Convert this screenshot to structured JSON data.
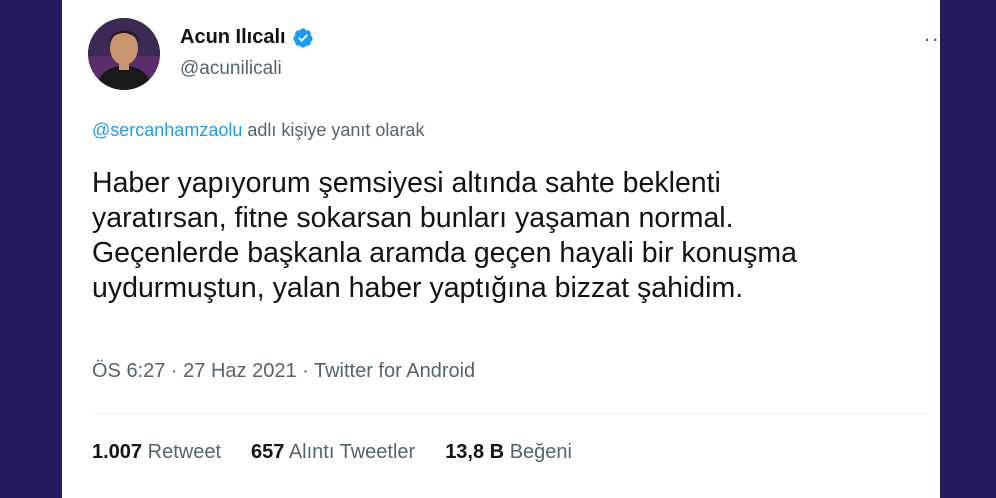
{
  "author": {
    "display_name": "Acun Ilıcalı",
    "handle": "@acunilicali",
    "avatar_icon": "person-portrait-icon",
    "verified_icon": "verified-badge-icon",
    "verified_color": "#1d9bf0"
  },
  "more_menu": {
    "label": "··",
    "icon": "more-options-icon"
  },
  "reply_context": {
    "user": "@sercanhamzaolu",
    "suffix": " adlı kişiye yanıt olarak"
  },
  "tweet": {
    "lines": [
      "Haber yapıyorum şemsiyesi altında sahte beklenti",
      "yaratırsan, fitne sokarsan bunları yaşaman normal.",
      "Geçenlerde başkanla aramda geçen hayali bir konuşma",
      "uydurmuştun, yalan haber yaptığına bizzat şahidim."
    ]
  },
  "meta": {
    "text": "ÖS 6:27 · 27 Haz 2021 · Twitter for Android"
  },
  "stats": {
    "retweets": {
      "count": "1.007",
      "label": "Retweet"
    },
    "quotes": {
      "count": "657",
      "label": "Alıntı Tweetler"
    },
    "likes": {
      "count": "13,8 B",
      "label": "Beğeni"
    }
  },
  "colors": {
    "background": "#2a1f63",
    "link": "#1d9bf0",
    "text": "#0f1419",
    "secondary": "#536471"
  }
}
